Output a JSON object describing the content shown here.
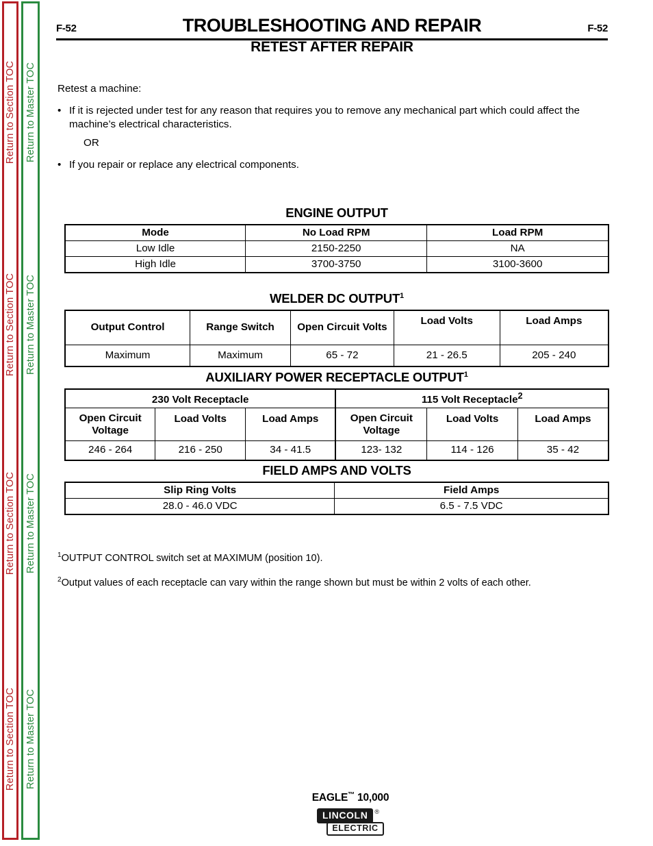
{
  "sidebar": {
    "section_toc_label": "Return to Section TOC",
    "master_toc_label": "Return to Master TOC",
    "section_color": "#b52026",
    "master_color": "#2a8b3f",
    "repeat_count": 4
  },
  "header": {
    "page_num_left": "F-52",
    "page_num_right": "F-52",
    "title": "TROUBLESHOOTING AND REPAIR",
    "subtitle": "RETEST AFTER REPAIR"
  },
  "intro": {
    "lead": "Retest a machine:",
    "bullet_1": "If it is rejected under test for any reason that requires you to remove any mechanical part which could affect the machine’s electrical characteristics.",
    "or": "OR",
    "bullet_2": "If you repair or replace any electrical components.",
    "bullet_marker": "•"
  },
  "tables": {
    "engine_output": {
      "title": "ENGINE OUTPUT",
      "title_sup": "",
      "headers": [
        "Mode",
        "No Load RPM",
        "Load RPM"
      ],
      "rows": [
        [
          "Low Idle",
          "2150-2250",
          "NA"
        ],
        [
          "High Idle",
          "3700-3750",
          "3100-3600"
        ]
      ]
    },
    "welder_dc_output": {
      "title": "WELDER DC OUTPUT",
      "title_sup": "1",
      "headers": [
        "Output Control",
        "Range Switch",
        "Open Circuit Volts",
        "Load Volts",
        "Load Amps"
      ],
      "rows": [
        [
          "Maximum",
          "Maximum",
          "65 - 72",
          "21 - 26.5",
          "205 - 240"
        ]
      ]
    },
    "auxiliary_power": {
      "title": "AUXILIARY POWER RECEPTACLE OUTPUT",
      "title_sup": "1",
      "group_headers": [
        {
          "label": "230 Volt Receptacle",
          "sup": ""
        },
        {
          "label": "115 Volt Receptacle",
          "sup": "2"
        }
      ],
      "headers": [
        "Open Circuit Voltage",
        "Load Volts",
        "Load Amps",
        "Open Circuit Voltage",
        "Load Volts",
        "Load Amps"
      ],
      "rows": [
        [
          "246 - 264",
          "216 - 250",
          "34 - 41.5",
          "123- 132",
          "114 - 126",
          "35 - 42"
        ]
      ]
    },
    "field_amps_volts": {
      "title": "FIELD AMPS AND VOLTS",
      "title_sup": "",
      "headers": [
        "Slip Ring Volts",
        "Field Amps"
      ],
      "rows": [
        [
          "28.0 - 46.0 VDC",
          "6.5 - 7.5 VDC"
        ]
      ]
    }
  },
  "footnotes": {
    "note_1_marker": "1",
    "note_1": "OUTPUT CONTROL switch set at MAXIMUM (position 10).",
    "note_2_marker": "2",
    "note_2": "Output values of each receptacle can vary within the range shown but must be within 2 volts of each other."
  },
  "footer": {
    "model": "EAGLE",
    "model_tm": "™",
    "model_number": " 10,000",
    "logo_line1": "LINCOLN",
    "logo_reg": "®",
    "logo_line2": "ELECTRIC"
  }
}
